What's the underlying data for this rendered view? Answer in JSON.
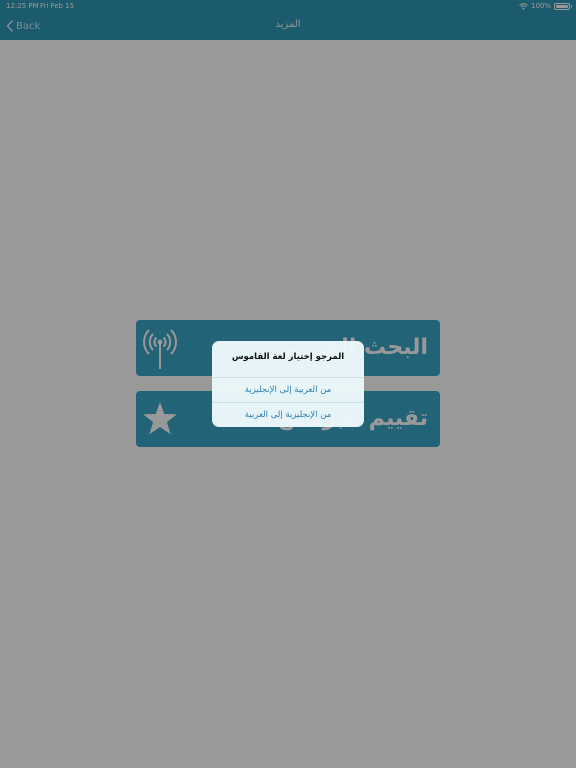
{
  "status_bar": {
    "time": "12:25 PM",
    "date": "Fri Feb 15",
    "battery": "100%",
    "wifi_icon": "wifi-icon",
    "battery_icon": "battery-icon"
  },
  "nav": {
    "back_label": "Back",
    "title": "المزيد",
    "back_icon": "chevron-left-icon"
  },
  "menu": {
    "items": [
      {
        "label": "البحث الصوتي",
        "icon": "antenna-icon"
      },
      {
        "label": "تقييم البرنامج",
        "icon": "star-icon"
      }
    ]
  },
  "alert": {
    "title": "المرجو إختيار لغة القاموس",
    "actions": [
      {
        "label": "من العربية إلى الإنجليزية"
      },
      {
        "label": "من الإنجليزية إلى العربية"
      }
    ]
  },
  "colors": {
    "nav_bar": "#2d98b6",
    "menu_button": "#3aa6c6",
    "alert_action_text": "#2e7fb0",
    "dim_overlay": "rgba(0,0,0,0.40)"
  }
}
